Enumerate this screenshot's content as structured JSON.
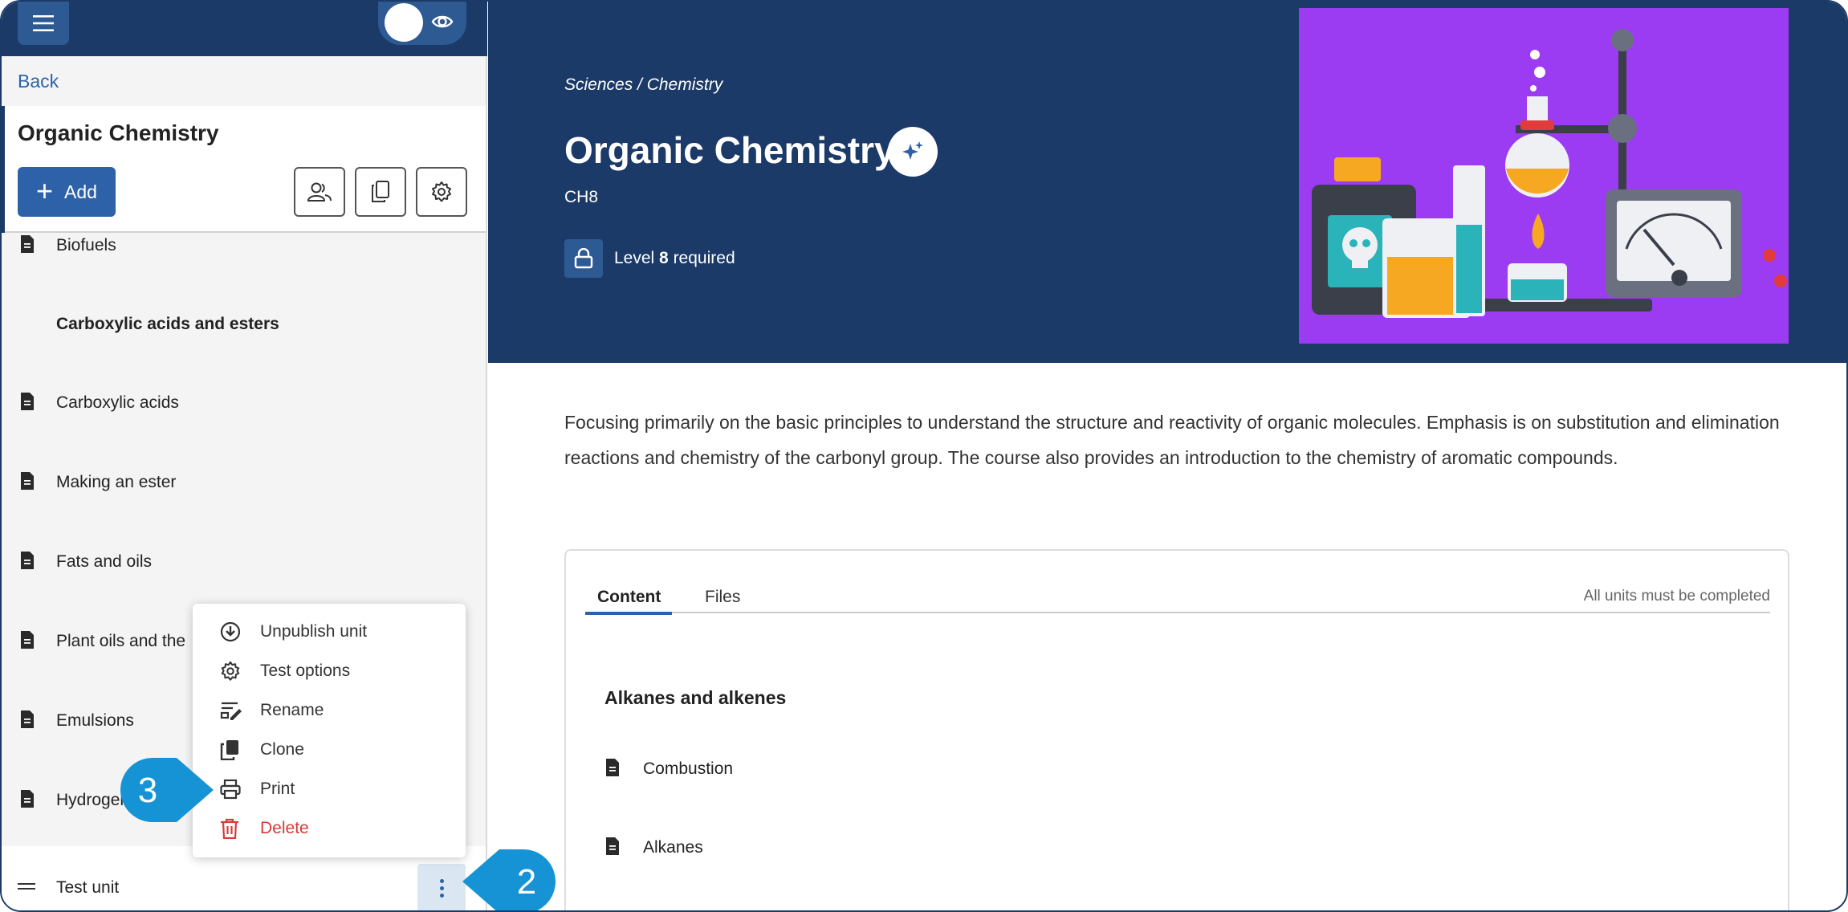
{
  "sidebar": {
    "back": "Back",
    "title": "Organic Chemistry",
    "add_label": "Add",
    "items": [
      {
        "label": "Biofuels",
        "bold": false,
        "icon": "document-icon"
      },
      {
        "label": "Carboxylic acids and esters",
        "bold": true,
        "icon": ""
      },
      {
        "label": "Carboxylic acids",
        "bold": false,
        "icon": "document-icon"
      },
      {
        "label": "Making an ester",
        "bold": false,
        "icon": "document-icon"
      },
      {
        "label": "Fats and oils",
        "bold": false,
        "icon": "document-icon"
      },
      {
        "label": "Plant oils and the",
        "bold": false,
        "icon": "document-icon"
      },
      {
        "label": "Emulsions",
        "bold": false,
        "icon": "document-icon"
      },
      {
        "label": "Hydrogen",
        "bold": false,
        "icon": "document-icon"
      }
    ],
    "selected_unit": "Test unit"
  },
  "context_menu": {
    "items": [
      {
        "label": "Unpublish unit",
        "icon": "unpublish-icon"
      },
      {
        "label": "Test options",
        "icon": "gear-icon"
      },
      {
        "label": "Rename",
        "icon": "rename-icon"
      },
      {
        "label": "Clone",
        "icon": "clone-icon"
      },
      {
        "label": "Print",
        "icon": "print-icon"
      },
      {
        "label": "Delete",
        "icon": "trash-icon"
      }
    ]
  },
  "callouts": {
    "step_2": "2",
    "step_3": "3"
  },
  "course": {
    "breadcrumb": "Sciences / Chemistry",
    "title": "Organic Chemistry",
    "code": "CH8",
    "level_prefix": "Level ",
    "level_number": "8",
    "level_suffix": " required",
    "description": "Focusing primarily on the basic principles to understand the structure and reactivity of organic molecules. Emphasis is on substitution and elimination reactions and chemistry of the carbonyl group. The course also provides an introduction to the chemistry of aromatic compounds."
  },
  "content_card": {
    "tabs": [
      "Content",
      "Files"
    ],
    "note": "All units must be completed",
    "section_title": "Alkanes and alkenes",
    "items": [
      "Combustion",
      "Alkanes"
    ]
  },
  "colors": {
    "navy": "#1b3a68",
    "accent": "#2e62a8",
    "danger": "#d93a3a",
    "callout": "#1593d4",
    "hero_image_bg": "#9b3bf2"
  }
}
